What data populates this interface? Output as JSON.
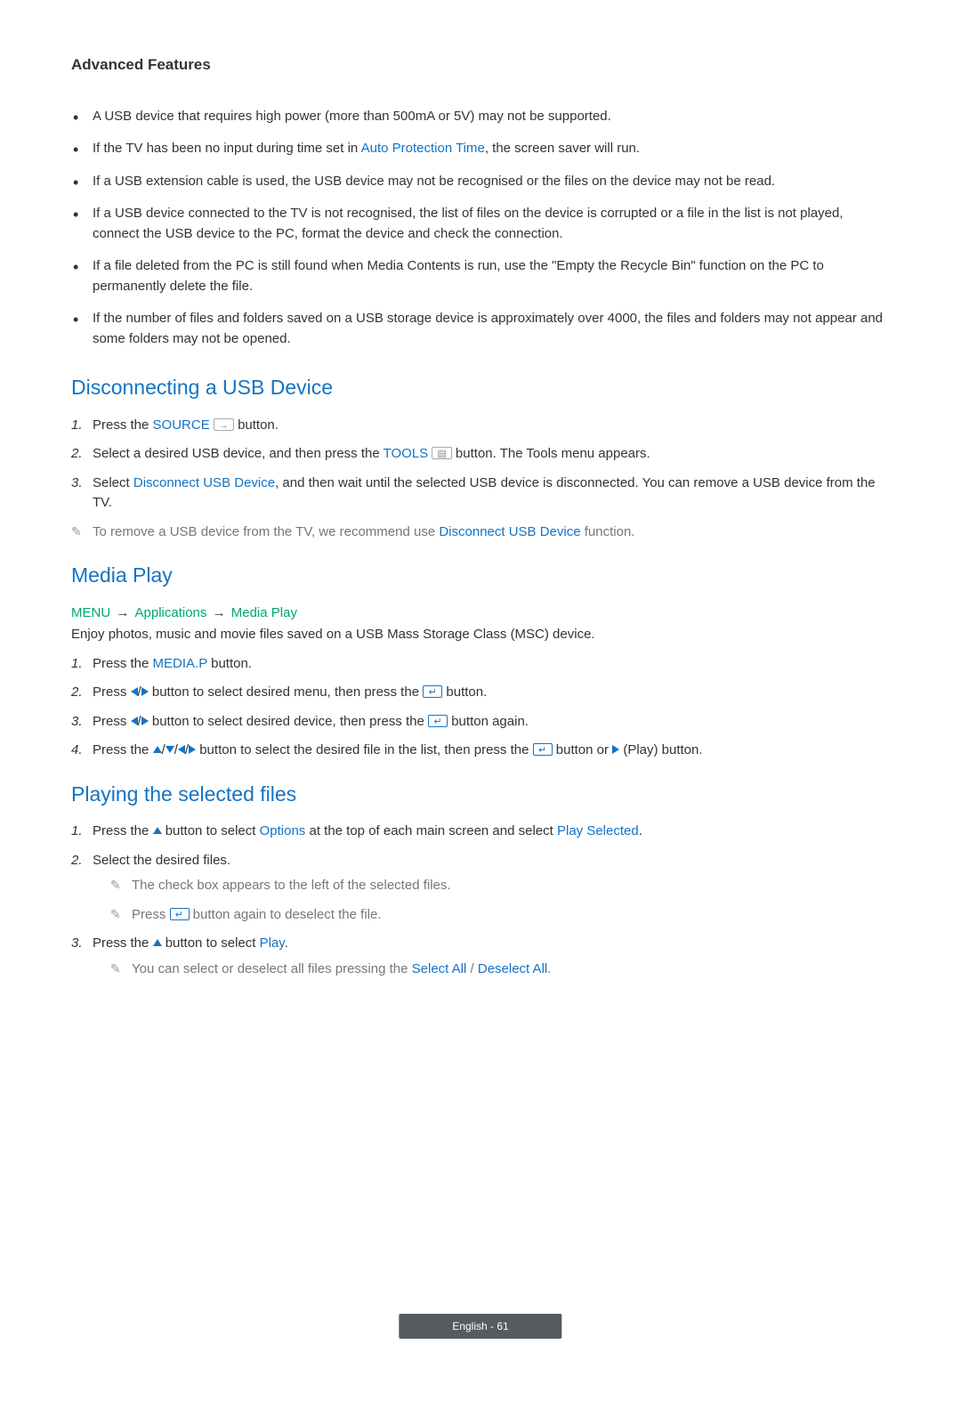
{
  "header": {
    "title": "Advanced Features"
  },
  "bullets": [
    {
      "pre": "A USB device that requires high power (more than 500mA or 5V) may not be supported."
    },
    {
      "pre": "If the TV has been no input during time set in ",
      "kw": "Auto Protection Time",
      "post": ", the screen saver will run."
    },
    {
      "pre": "If a USB extension cable is used, the USB device may not be recognised or the files on the device may not be read."
    },
    {
      "pre": "If a USB device connected to the TV is not recognised, the list of files on the device is corrupted or a file in the list is not played, connect the USB device to the PC, format the device and check the connection."
    },
    {
      "pre": "If a file deleted from the PC is still found when Media Contents is run, use the \"Empty the Recycle Bin\" function on the PC to permanently delete the file."
    },
    {
      "pre": "If the number of files and folders saved on a USB storage device is approximately over 4000, the files and folders may not appear and some folders may not be opened."
    }
  ],
  "sections": {
    "disconnect": {
      "heading": "Disconnecting a USB Device",
      "step1_pre": "Press the ",
      "step1_kw": "SOURCE",
      "step1_post": " button.",
      "step2_pre": "Select a desired USB device, and then press the ",
      "step2_kw": "TOOLS",
      "step2_post": " button. The Tools menu appears.",
      "step3_pre": "Select ",
      "step3_kw": "Disconnect USB Device",
      "step3_post": ", and then wait until the selected USB device is disconnected. You can remove a USB device from the TV.",
      "note_pre": "To remove a USB device from the TV, we recommend use ",
      "note_kw": "Disconnect USB Device",
      "note_post": " function."
    },
    "media": {
      "heading": "Media Play",
      "bc1": "MENU",
      "bc2": "Applications",
      "bc3": "Media Play",
      "intro": "Enjoy photos, music and movie files saved on a USB Mass Storage Class (MSC) device.",
      "s1_pre": "Press the ",
      "s1_kw": "MEDIA.P",
      "s1_post": " button.",
      "s2_pre": "Press ",
      "s2_mid": " button to select desired menu, then press the ",
      "s2_post": " button.",
      "s3_pre": "Press ",
      "s3_mid": " button to select desired device, then press the ",
      "s3_post": " button again.",
      "s4_pre": "Press the ",
      "s4_mid": " button to select the desired file in the list, then press the ",
      "s4_mid2": " button or ",
      "s4_post": " (Play) button."
    },
    "playing": {
      "heading": "Playing the selected files",
      "s1_pre": "Press the ",
      "s1_mid": " button to select ",
      "s1_kw1": "Options",
      "s1_mid2": " at the top of each main screen and select ",
      "s1_kw2": "Play Selected",
      "s1_post": ".",
      "s2": "Select the desired files.",
      "s2_n1": "The check box appears to the left of the selected files.",
      "s2_n2_pre": "Press ",
      "s2_n2_post": " button again to deselect the file.",
      "s3_pre": "Press the ",
      "s3_mid": " button to select ",
      "s3_kw": "Play",
      "s3_post": ".",
      "s3_n_pre": "You can select or deselect all files pressing the ",
      "s3_n_kw1": "Select All",
      "s3_n_sep": " / ",
      "s3_n_kw2": "Deselect All",
      "s3_n_post": "."
    }
  },
  "footer": {
    "label": "English - 61"
  },
  "icons": {
    "enter_glyph": "↵",
    "source_glyph": "→",
    "tools_glyph": "▤"
  }
}
